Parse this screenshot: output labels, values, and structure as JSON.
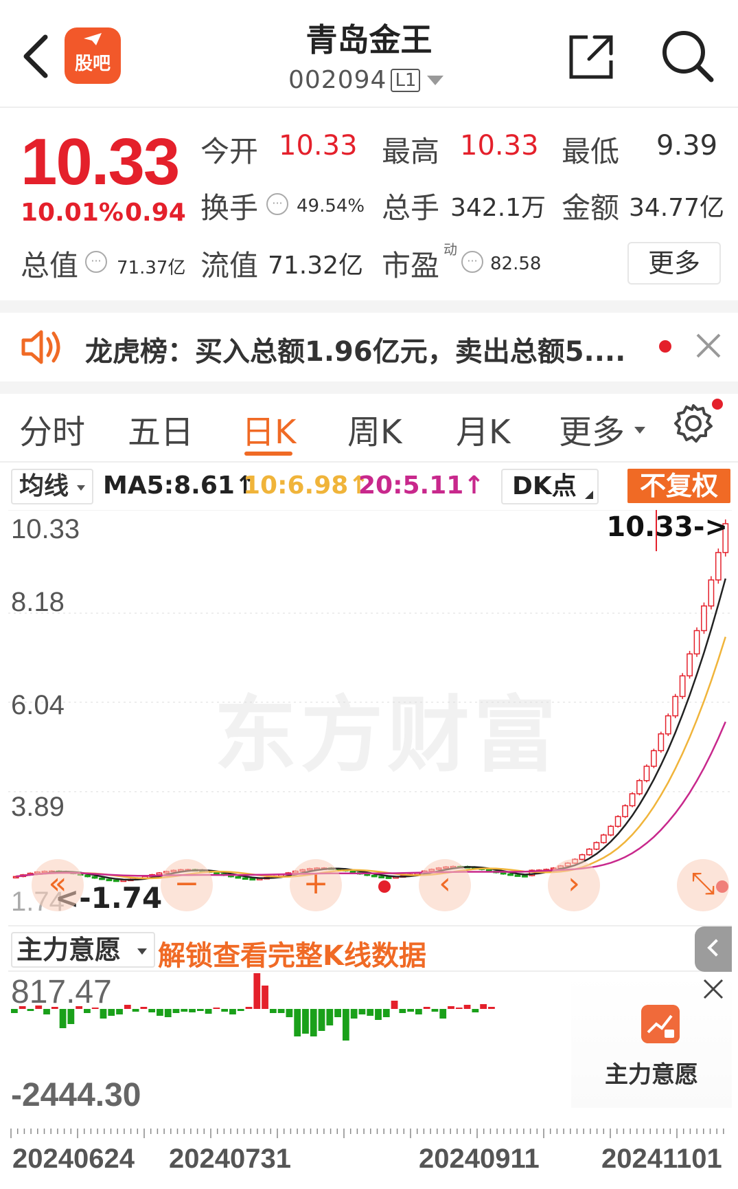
{
  "header": {
    "title": "青岛金王",
    "code": "002094",
    "level": "L1",
    "app_logo_label": "股吧"
  },
  "quote": {
    "price": "10.33",
    "change_pct": "10.01%",
    "change": "0.94",
    "open_label": "今开",
    "open": "10.33",
    "high_label": "最高",
    "high": "10.33",
    "low_label": "最低",
    "low": "9.39",
    "turnover_label": "换手",
    "turnover": "49.54%",
    "volume_label": "总手",
    "volume": "342.1万",
    "amount_label": "金额",
    "amount": "34.77亿",
    "mktcap_label": "总值",
    "mktcap": "71.37亿",
    "float_label": "流值",
    "float_cap": "71.32亿",
    "pe_label": "市盈",
    "pe_mark": "动",
    "pe": "82.58",
    "more_label": "更多"
  },
  "notice": {
    "text": "龙虎榜：买入总额1.96亿元，卖出总额5...."
  },
  "tabs": [
    "分时",
    "五日",
    "日K",
    "周K",
    "月K",
    "更多"
  ],
  "active_tab": "日K",
  "ma": {
    "selector": "均线",
    "ma5": "MA5:8.61↑",
    "ma10": "10:6.98↑",
    "ma20": "20:5.11↑",
    "dk_label": "DK点",
    "adjust_label": "不复权",
    "colors": {
      "ma5": "#222222",
      "ma10": "#f0b43a",
      "ma20": "#c8288c"
    }
  },
  "kchart": {
    "y_labels": [
      "10.33",
      "8.18",
      "6.04",
      "3.89",
      "1.74"
    ],
    "last_price_tag": "10.33->",
    "min_tag": "<-1.74",
    "watermark": "东方财富"
  },
  "chart_data": {
    "type": "bar",
    "ylim": [
      1.74,
      10.33
    ],
    "x": [
      "20240624",
      "20240731",
      "20240911",
      "20241101"
    ],
    "series": [
      {
        "name": "MA5",
        "value": 8.61
      },
      {
        "name": "10",
        "value": 6.98
      },
      {
        "name": "20",
        "value": 5.11
      }
    ],
    "indicator_ylim": [
      -2444.3,
      817.47
    ]
  },
  "mainforce": {
    "selector": "主力意愿",
    "unlock_link": "解锁查看完整K线数据",
    "max": "817.47",
    "min": "-2444.30",
    "card_title": "主力意愿"
  },
  "dates": [
    "20240624",
    "20240731",
    "20240911",
    "20241101"
  ],
  "colors": {
    "up": "#e4202b",
    "down": "#1aa01a",
    "accent": "#f06a25"
  }
}
